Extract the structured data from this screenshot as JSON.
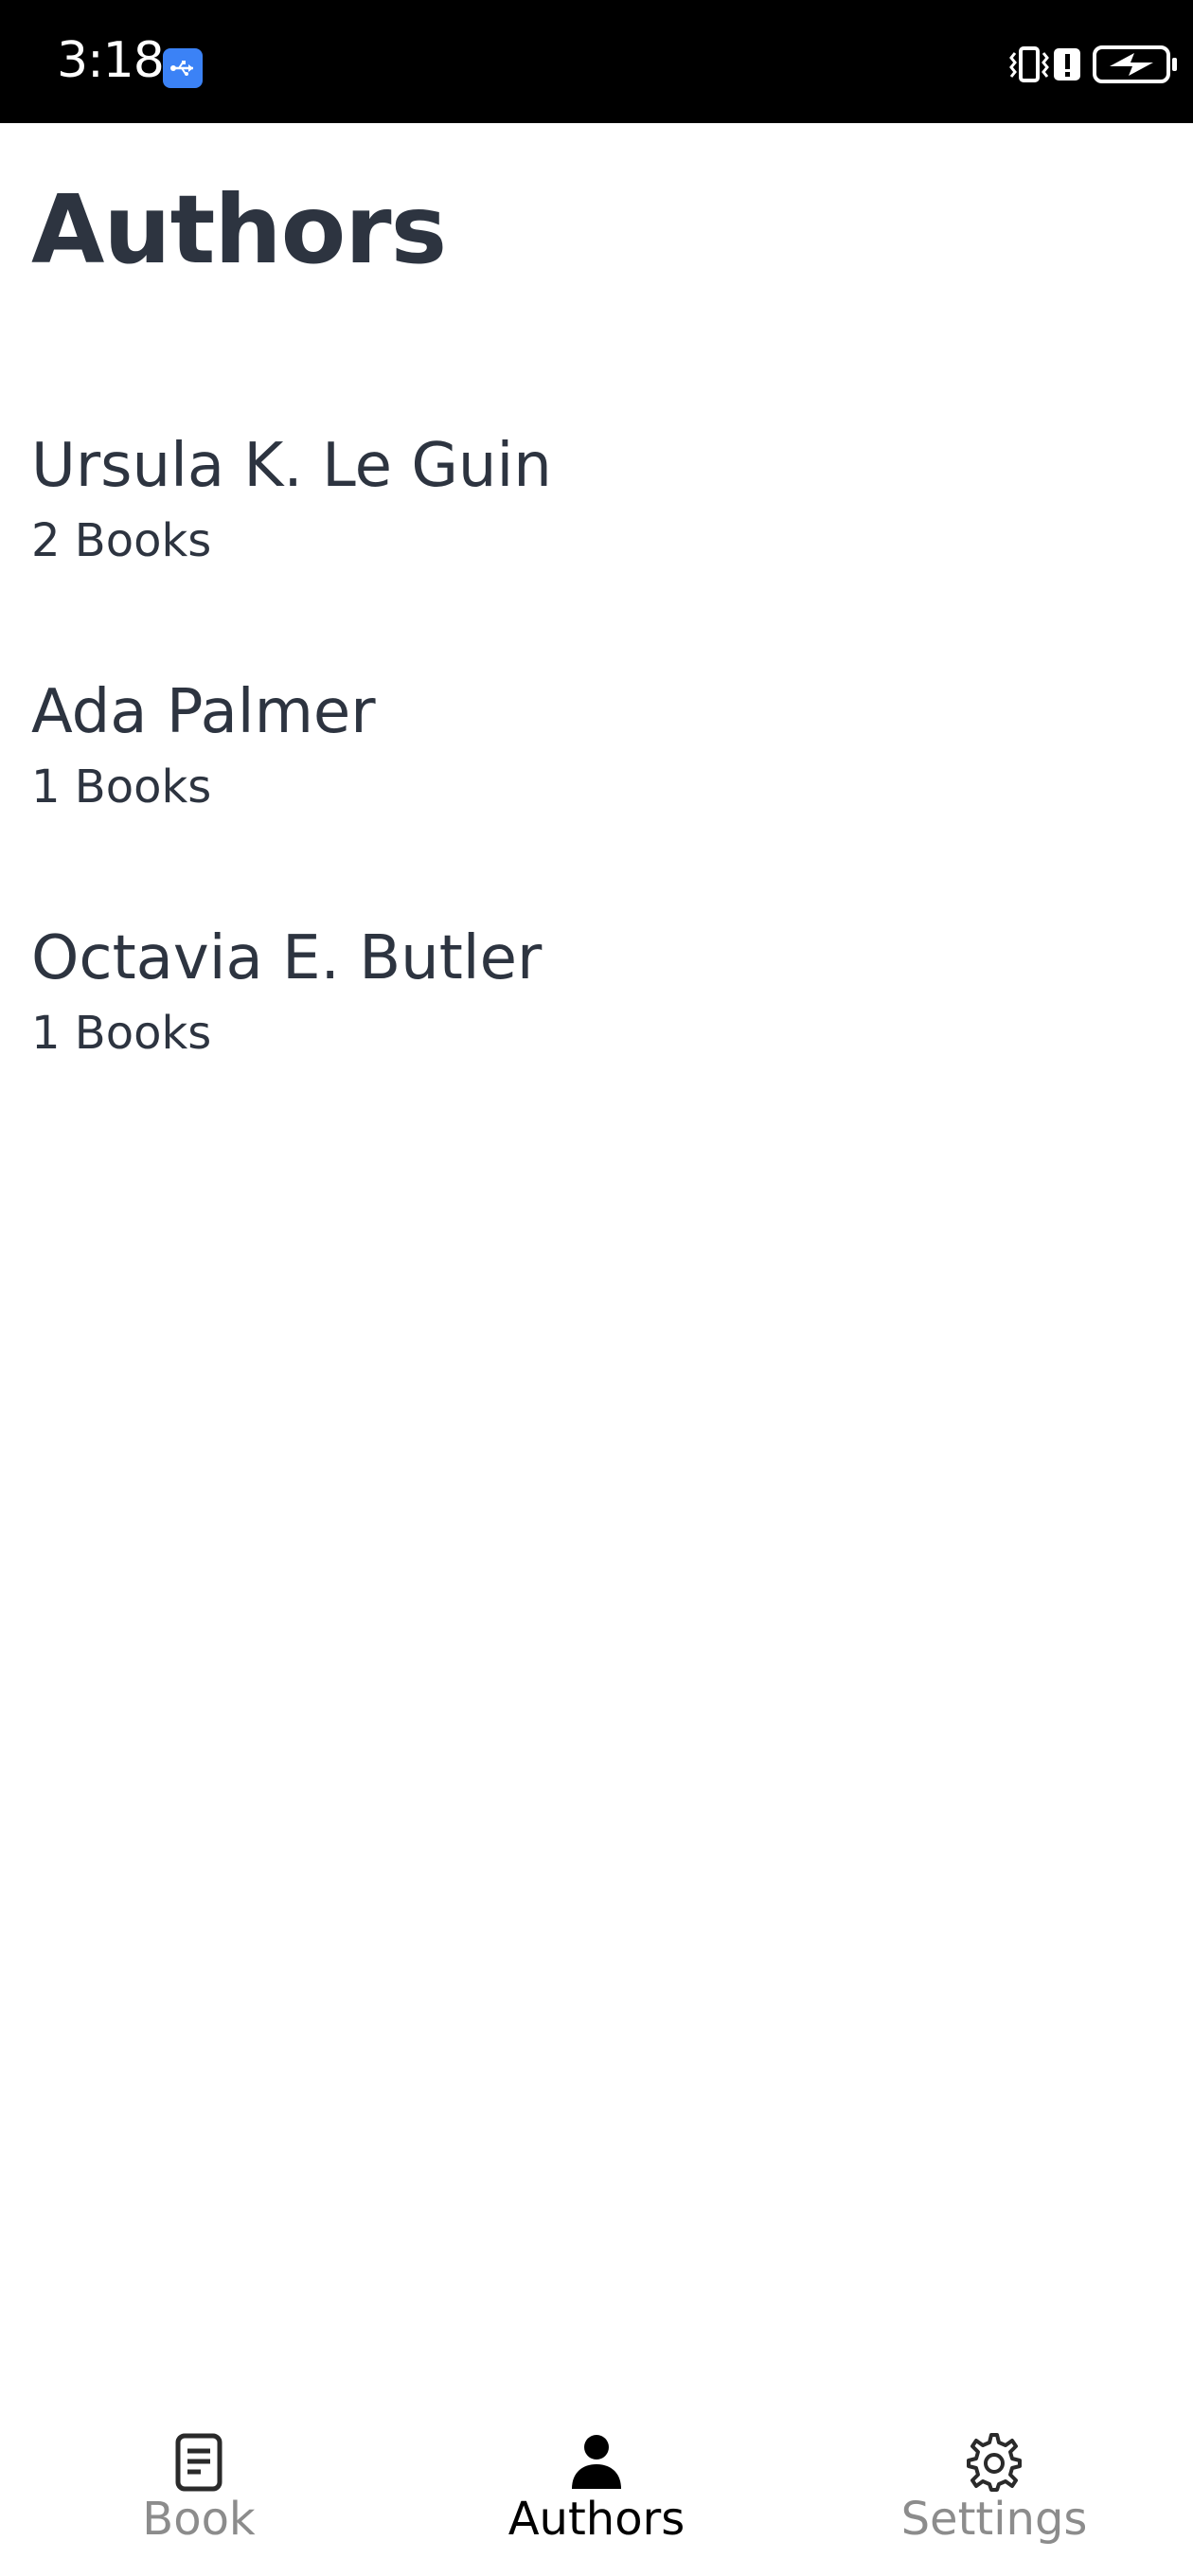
{
  "status_bar": {
    "time": "3:18",
    "icons": [
      "usb-debug-icon",
      "vibrate-icon",
      "alert-icon",
      "battery-charging-icon"
    ]
  },
  "page": {
    "title": "Authors"
  },
  "authors": [
    {
      "name": "Ursula K. Le Guin",
      "count": "2 Books"
    },
    {
      "name": "Ada Palmer",
      "count": "1 Books"
    },
    {
      "name": "Octavia E. Butler",
      "count": "1 Books"
    }
  ],
  "bottom_nav": {
    "items": [
      {
        "label": "Book",
        "icon": "document-icon",
        "active": false
      },
      {
        "label": "Authors",
        "icon": "person-icon",
        "active": true
      },
      {
        "label": "Settings",
        "icon": "gear-icon",
        "active": false
      }
    ]
  },
  "colors": {
    "text_primary": "#2d3440",
    "nav_active": "#000000",
    "nav_inactive": "#8c8c8c",
    "status_bar_bg": "#000000",
    "usb_badge": "#3b82f6"
  }
}
